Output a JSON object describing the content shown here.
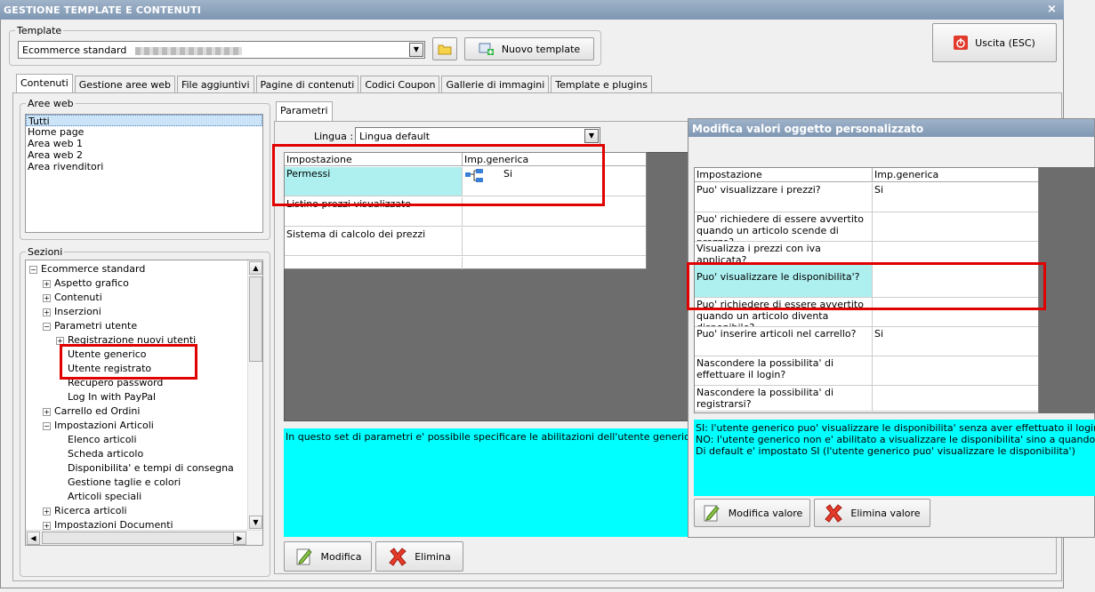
{
  "window": {
    "title": "GESTIONE TEMPLATE E CONTENUTI",
    "close_glyph": "×"
  },
  "template_group": {
    "legend": "Template",
    "selected": "Ecommerce standard",
    "new_button": "Nuovo template"
  },
  "exit_button": "Uscita (ESC)",
  "tabs": [
    "Contenuti",
    "Gestione aree web",
    "File aggiuntivi",
    "Pagine di contenuti",
    "Codici Coupon",
    "Gallerie di immagini",
    "Template e plugins"
  ],
  "aree_web": {
    "legend": "Aree web",
    "items": [
      "Tutti",
      "Home page",
      "Area web 1",
      "Area web 2",
      "Area rivenditori"
    ]
  },
  "sezioni": {
    "legend": "Sezioni",
    "tree": [
      {
        "label": "Ecommerce standard",
        "level": 0,
        "sign": "−"
      },
      {
        "label": "Aspetto grafico",
        "level": 1,
        "sign": "+"
      },
      {
        "label": "Contenuti",
        "level": 1,
        "sign": "+"
      },
      {
        "label": "Inserzioni",
        "level": 1,
        "sign": "+"
      },
      {
        "label": "Parametri utente",
        "level": 1,
        "sign": "−"
      },
      {
        "label": "Registrazione nuovi utenti",
        "level": 2,
        "sign": "+"
      },
      {
        "label": "Utente generico",
        "level": 2,
        "sign": ""
      },
      {
        "label": "Utente registrato",
        "level": 2,
        "sign": ""
      },
      {
        "label": "Recupero password",
        "level": 2,
        "sign": ""
      },
      {
        "label": "Log In with PayPal",
        "level": 2,
        "sign": ""
      },
      {
        "label": "Carrello ed Ordini",
        "level": 1,
        "sign": "+"
      },
      {
        "label": "Impostazioni Articoli",
        "level": 1,
        "sign": "−"
      },
      {
        "label": "Elenco articoli",
        "level": 2,
        "sign": ""
      },
      {
        "label": "Scheda articolo",
        "level": 2,
        "sign": ""
      },
      {
        "label": "Disponibilita' e tempi di consegna",
        "level": 2,
        "sign": ""
      },
      {
        "label": "Gestione taglie e colori",
        "level": 2,
        "sign": ""
      },
      {
        "label": "Articoli speciali",
        "level": 2,
        "sign": ""
      },
      {
        "label": "Ricerca articoli",
        "level": 1,
        "sign": "+"
      },
      {
        "label": "Impostazioni Documenti",
        "level": 1,
        "sign": "+"
      }
    ]
  },
  "parametri": {
    "tab": "Parametri",
    "lingua_label": "Lingua :",
    "lingua_value": "Lingua default",
    "col1": "Impostazione",
    "col2": "Imp.generica",
    "rows": [
      {
        "name": "Permessi",
        "value": "Si"
      },
      {
        "name": "Listino prezzi visualizzato",
        "value": ""
      },
      {
        "name": "Sistema di calcolo dei prezzi",
        "value": ""
      }
    ],
    "description": "In questo set di parametri e' possibile specificare le abilitazioni dell'utente generico per la navig",
    "modifica": "Modifica",
    "elimina": "Elimina"
  },
  "dialog": {
    "title": "Modifica valori oggetto personalizzato",
    "col1": "Impostazione",
    "col2": "Imp.generica",
    "rows": [
      {
        "name": "Puo' visualizzare i prezzi?",
        "value": "Si"
      },
      {
        "name": "Puo' richiedere di essere avvertito quando un articolo scende di prezzo?",
        "value": ""
      },
      {
        "name": "Visualizza i prezzi con iva applicata?",
        "value": ""
      },
      {
        "name": "Puo' visualizzare le disponibilita'?",
        "value": ""
      },
      {
        "name": "Puo' richiedere di essere avvertito quando un articolo diventa disponibile?",
        "value": ""
      },
      {
        "name": "Puo' inserire articoli nel carrello?",
        "value": "Si"
      },
      {
        "name": "Nascondere la possibilita' di effettuare il login?",
        "value": ""
      },
      {
        "name": "Nascondere la possibilita' di registrarsi?",
        "value": ""
      }
    ],
    "info": [
      "SI: l'utente generico puo' visualizzare le disponibilita' senza aver effettuato il login.",
      "NO: l'utente generico non e' abilitato a visualizzare le disponibilita' sino a quando non avra' eff",
      "Di default e' impostato SI (l'utente generico puo' visualizzare le disponibilita')"
    ],
    "modifica": "Modifica valore",
    "elimina": "Elimina valore"
  },
  "colors": {
    "highlight": "#e00000",
    "info_bg": "#00ffff",
    "selected_row": "#aef0f0",
    "grey_area": "#6d6d6d"
  }
}
